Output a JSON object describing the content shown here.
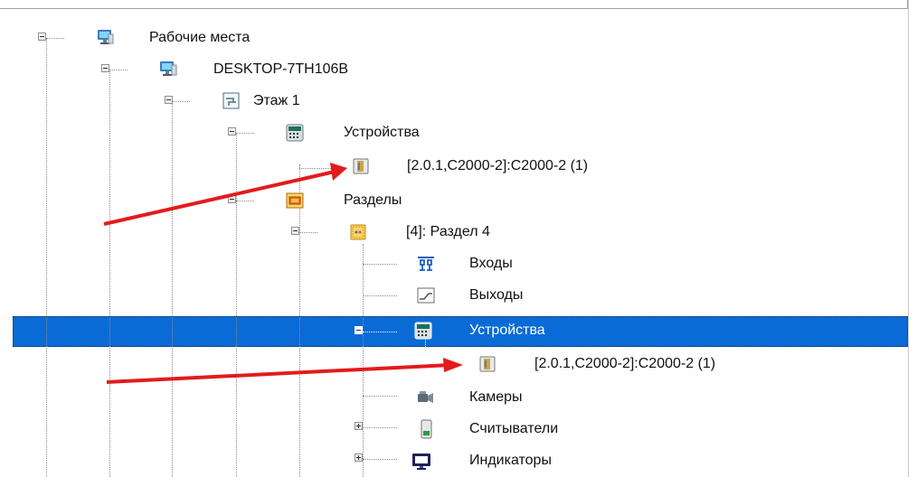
{
  "tree": {
    "nodes": [
      {
        "label": "Рабочие места",
        "icon": "workstation-icon"
      },
      {
        "label": "DESKTOP-7TH106B",
        "icon": "computer-icon"
      },
      {
        "label": "Этаж 1",
        "icon": "floor-plan-icon"
      },
      {
        "label": "Устройства",
        "icon": "devices-icon"
      },
      {
        "label": "[2.0.1,С2000-2]:С2000-2 (1)",
        "icon": "controller-icon"
      },
      {
        "label": "Разделы",
        "icon": "sections-icon"
      },
      {
        "label": "[4]: Раздел 4",
        "icon": "section-icon"
      },
      {
        "label": "Входы",
        "icon": "inputs-icon"
      },
      {
        "label": "Выходы",
        "icon": "outputs-icon"
      },
      {
        "label": "Устройства",
        "icon": "devices-icon",
        "selected": true
      },
      {
        "label": "[2.0.1,С2000-2]:С2000-2 (1)",
        "icon": "controller-icon"
      },
      {
        "label": "Камеры",
        "icon": "camera-icon"
      },
      {
        "label": "Считыватели",
        "icon": "reader-icon"
      },
      {
        "label": "Индикаторы",
        "icon": "monitor-icon"
      }
    ],
    "selection_color": "#0a6bd6",
    "arrow_color": "#e31b1b"
  }
}
